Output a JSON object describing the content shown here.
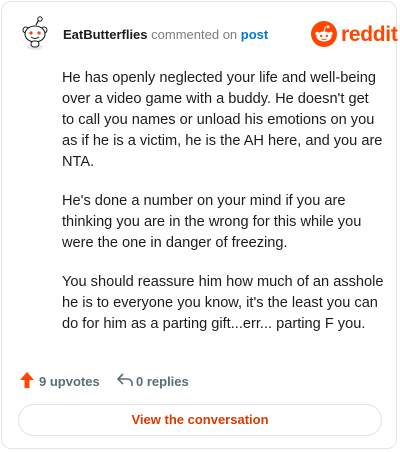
{
  "header": {
    "username": "EatButterflies",
    "action_text": "commented on",
    "post_link": "post",
    "brand": "reddit",
    "avatar_icon": "snoo-avatar-icon",
    "logo_icon": "reddit-logo-icon"
  },
  "comment": {
    "paragraphs": [
      "He has openly neglected your life and well-being over a video game with a buddy. He doesn't get to call you names or unload his emotions on you as if he is a victim, he is the AH here, and you are NTA.",
      "He's done a number on your mind if you are thinking you are in the wrong for this while you were the one in danger of freezing.",
      "You should reassure him how much of an asshole he is to everyone you know, it's the least you can do for him as a parting gift...err... parting F you."
    ]
  },
  "stats": {
    "upvotes": "9 upvotes",
    "replies": "0 replies",
    "upvote_icon": "upvote-arrow-icon",
    "reply_icon": "reply-arrow-icon"
  },
  "cta": {
    "label": "View the conversation"
  },
  "colors": {
    "brand": "#ff4500",
    "link": "#0079d3",
    "cta_text": "#d93a00"
  }
}
